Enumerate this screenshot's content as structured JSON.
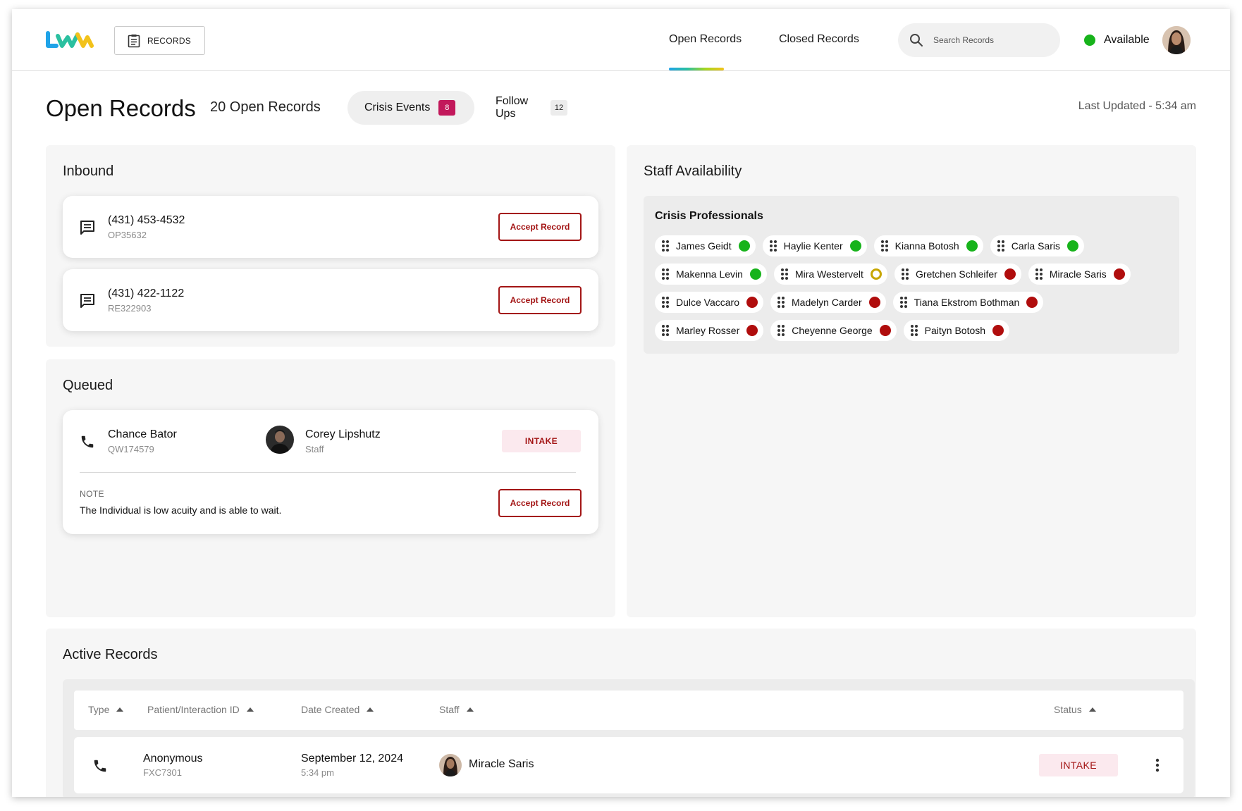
{
  "header": {
    "records_label": "RECORDS",
    "nav": [
      "Open Records",
      "Closed Records"
    ],
    "search_placeholder": "Search Records",
    "status_label": "Available",
    "status_color": "#17b31b"
  },
  "title_row": {
    "title": "Open Records",
    "count_label": "20 Open Records",
    "tabs": [
      {
        "label": "Crisis Events",
        "count": "8"
      },
      {
        "label": "Follow Ups",
        "count": "12"
      }
    ],
    "last_updated": "Last Updated - 5:34 am"
  },
  "inbound": {
    "title": "Inbound",
    "items": [
      {
        "phone": "(431) 453-4532",
        "id": "OP35632",
        "button": "Accept Record"
      },
      {
        "phone": "(431) 422-1122",
        "id": "RE322903",
        "button": "Accept Record"
      }
    ]
  },
  "queued": {
    "title": "Queued",
    "item": {
      "name": "Chance Bator",
      "id": "QW174579",
      "staff_name": "Corey Lipshutz",
      "staff_role": "Staff",
      "status": "INTAKE",
      "note_label": "NOTE",
      "note": "The Individual is low acuity and is able to wait.",
      "button": "Accept Record"
    }
  },
  "staff": {
    "title": "Staff Availability",
    "group": "Crisis Professionals",
    "status_colors": {
      "available": "#17b31b",
      "away": "#c7a600",
      "busy": "#b00d0d"
    },
    "rows": [
      [
        {
          "name": "James Geidt",
          "status": "available"
        },
        {
          "name": "Haylie Kenter",
          "status": "available"
        },
        {
          "name": "Kianna Botosh",
          "status": "available"
        },
        {
          "name": "Carla Saris",
          "status": "available"
        }
      ],
      [
        {
          "name": "Makenna Levin",
          "status": "available"
        },
        {
          "name": "Mira Westervelt",
          "status": "away"
        },
        {
          "name": "Gretchen Schleifer",
          "status": "busy"
        },
        {
          "name": "Miracle Saris",
          "status": "busy"
        }
      ],
      [
        {
          "name": "Dulce Vaccaro",
          "status": "busy"
        },
        {
          "name": "Madelyn Carder",
          "status": "busy"
        },
        {
          "name": "Tiana Ekstrom Bothman",
          "status": "busy"
        }
      ],
      [
        {
          "name": "Marley Rosser",
          "status": "busy"
        },
        {
          "name": "Cheyenne George",
          "status": "busy"
        },
        {
          "name": "Paityn Botosh",
          "status": "busy"
        }
      ]
    ]
  },
  "active": {
    "title": "Active Records",
    "columns": [
      "Type",
      "Patient/Interaction ID",
      "Date Created",
      "Staff",
      "Status"
    ],
    "rows": [
      {
        "name": "Anonymous",
        "id": "FXC7301",
        "date": "September 12, 2024",
        "time": "5:34 pm",
        "staff": "Miracle Saris",
        "status": "INTAKE"
      }
    ]
  }
}
